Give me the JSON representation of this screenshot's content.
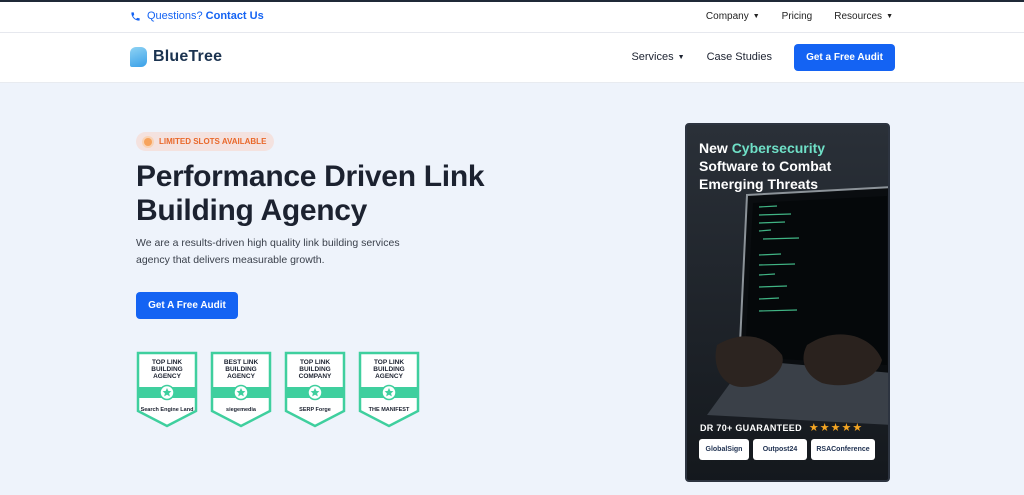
{
  "topbar": {
    "question": "Questions?",
    "contact": "Contact Us",
    "nav": [
      {
        "label": "Company",
        "has_dropdown": true
      },
      {
        "label": "Pricing",
        "has_dropdown": false
      },
      {
        "label": "Resources",
        "has_dropdown": true
      }
    ]
  },
  "header": {
    "logo": "BlueTree",
    "nav": [
      {
        "label": "Services",
        "has_dropdown": true
      },
      {
        "label": "Case Studies",
        "has_dropdown": false
      }
    ],
    "cta": "Get a Free Audit"
  },
  "hero": {
    "badge": "LIMITED SLOTS AVAILABLE",
    "title": "Performance Driven Link Building Agency",
    "subtitle": "We are a results-driven high quality link building services agency that delivers measurable growth.",
    "cta": "Get A Free Audit"
  },
  "awards": [
    {
      "label": "TOP LINK BUILDING AGENCY",
      "source": "Search Engine Land"
    },
    {
      "label": "BEST LINK BUILDING AGENCY",
      "source": "siegemedia"
    },
    {
      "label": "TOP LINK BUILDING COMPANY",
      "source": "SERP Forge"
    },
    {
      "label": "TOP LINK BUILDING AGENCY",
      "source": "THE MANIFEST"
    }
  ],
  "case_card": {
    "heading_pre": "New ",
    "heading_accent": "Cybersecurity",
    "heading_post": " Software to Combat Emerging Threats",
    "dr": "DR 70+ GUARANTEED",
    "stars": "★★★★★",
    "partners": [
      "GlobalSign",
      "Outpost24",
      "RSAConference"
    ]
  },
  "colors": {
    "primary": "#1463f3",
    "accent": "#6fe0c7",
    "award_green": "#3fcf9e",
    "badge_text": "#e9682a",
    "background": "#eef3fb"
  }
}
